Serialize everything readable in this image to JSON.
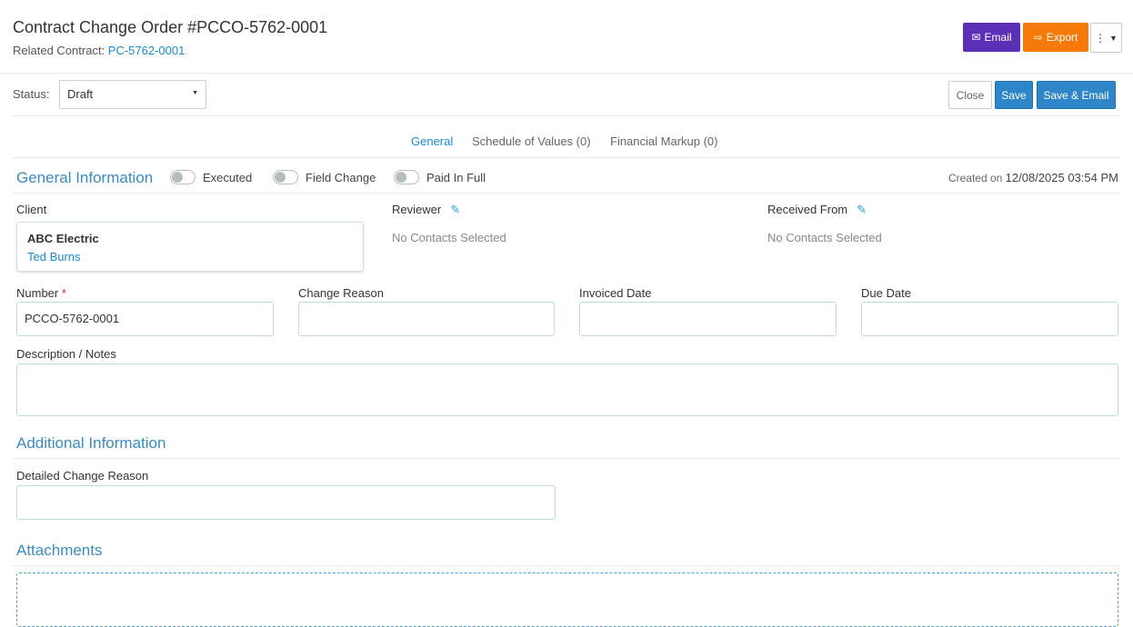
{
  "header": {
    "title": "Contract Change Order #PCCO-5762-0001",
    "related_label": "Related Contract:",
    "related_link": "PC-5762-0001"
  },
  "toolbar": {
    "email": "Email",
    "export": "Export",
    "close": "Close",
    "save": "Save",
    "save_email": "Save & Email"
  },
  "status": {
    "label": "Status:",
    "value": "Draft"
  },
  "tabs": [
    "General",
    "Schedule of Values (0)",
    "Financial Markup (0)"
  ],
  "general": {
    "title": "General Information",
    "toggles": [
      "Executed",
      "Field Change",
      "Paid In Full"
    ],
    "created_label": "Created on",
    "created_value": "12/08/2025 03:54 PM"
  },
  "client": {
    "label": "Client",
    "name": "ABC Electric",
    "contact": "Ted Burns"
  },
  "reviewer": {
    "label": "Reviewer",
    "value": "No Contacts Selected"
  },
  "received": {
    "label": "Received From",
    "value": "No Contacts Selected"
  },
  "fields": {
    "number_label": "Number",
    "required": "*",
    "number_value": "PCCO-5762-0001",
    "change_reason": "Change Reason",
    "invoiced_date": "Invoiced Date",
    "due_date": "Due Date",
    "description": "Description / Notes"
  },
  "additional": {
    "title": "Additional Information",
    "detailed_reason": "Detailed Change Reason"
  },
  "attachments": {
    "title": "Attachments"
  },
  "colors": {
    "email": "#5b2fb6",
    "export": "#f57a0a",
    "save": "#2e86c8"
  }
}
